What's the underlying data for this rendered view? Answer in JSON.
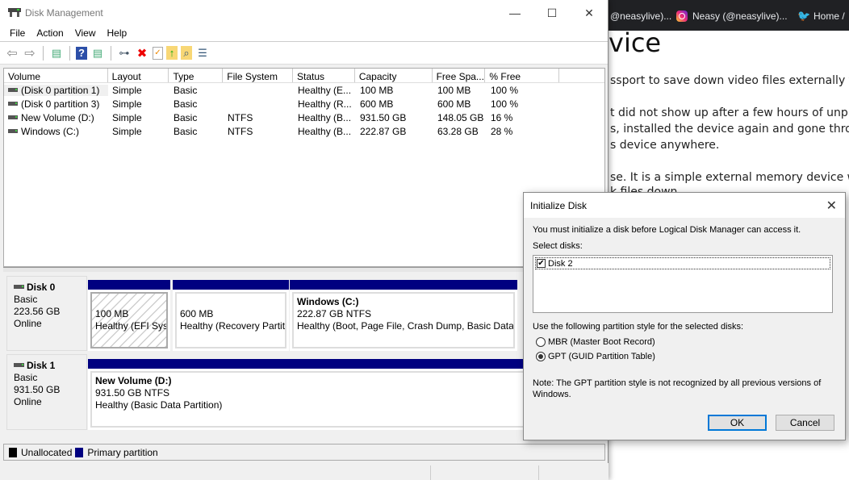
{
  "browser": {
    "bookmarks": [
      {
        "label": "@neasylive)...",
        "icon": "instagram-icon"
      },
      {
        "label": "Neasy (@neasylive)...",
        "icon": "instagram-icon"
      },
      {
        "label": "Home /",
        "icon": "twitter-icon"
      }
    ],
    "heading": "vice",
    "lines": [
      "ssport to save down video files externally for m",
      "t did not show up after a few hours of unplugg",
      "s, installed the device again and gone through",
      "s device anywhere.",
      "se. It is a simple external memory device why",
      "k files down"
    ]
  },
  "window": {
    "title": "Disk Management",
    "controls": {
      "minimize": "—",
      "maximize": "☐",
      "close": "✕"
    },
    "menu": [
      "File",
      "Action",
      "View",
      "Help"
    ],
    "toolbar": [
      {
        "name": "back-icon",
        "glyph": "⇦"
      },
      {
        "name": "forward-icon",
        "glyph": "⇨"
      },
      {
        "name": "show-hide-console-tree-icon",
        "glyph": "▤"
      },
      {
        "name": "help-icon",
        "glyph": "?"
      },
      {
        "name": "show-hide-action-pane-icon",
        "glyph": "▤"
      },
      {
        "name": "connect-drive-icon",
        "glyph": "⊶"
      },
      {
        "name": "delete-icon",
        "glyph": "✖"
      },
      {
        "name": "properties-icon",
        "glyph": "✓"
      },
      {
        "name": "export-icon",
        "glyph": "↑"
      },
      {
        "name": "find-icon",
        "glyph": "⌕"
      },
      {
        "name": "settings-list-icon",
        "glyph": "☰"
      }
    ]
  },
  "volumes": {
    "columns": [
      "Volume",
      "Layout",
      "Type",
      "File System",
      "Status",
      "Capacity",
      "Free Spa...",
      "% Free"
    ],
    "rows": [
      [
        "(Disk 0 partition 1)",
        "Simple",
        "Basic",
        "",
        "Healthy (E...",
        "100 MB",
        "100 MB",
        "100 %"
      ],
      [
        "(Disk 0 partition 3)",
        "Simple",
        "Basic",
        "",
        "Healthy (R...",
        "600 MB",
        "600 MB",
        "100 %"
      ],
      [
        "New Volume (D:)",
        "Simple",
        "Basic",
        "NTFS",
        "Healthy (B...",
        "931.50 GB",
        "148.05 GB",
        "16 %"
      ],
      [
        "Windows (C:)",
        "Simple",
        "Basic",
        "NTFS",
        "Healthy (B...",
        "222.87 GB",
        "63.28 GB",
        "28 %"
      ]
    ]
  },
  "disks": [
    {
      "name": "Disk 0",
      "type": "Basic",
      "size": "223.56 GB",
      "status": "Online",
      "partitions": [
        {
          "title": "",
          "size": "100 MB",
          "status": "Healthy (EFI Syst"
        },
        {
          "title": "",
          "size": "600 MB",
          "status": "Healthy (Recovery Partiti"
        },
        {
          "title": "Windows  (C:)",
          "size": "222.87 GB NTFS",
          "status": "Healthy (Boot, Page File, Crash Dump, Basic Data P"
        }
      ]
    },
    {
      "name": "Disk 1",
      "type": "Basic",
      "size": "931.50 GB",
      "status": "Online",
      "partitions": [
        {
          "title": "New Volume  (D:)",
          "size": "931.50 GB NTFS",
          "status": "Healthy (Basic Data Partition)"
        }
      ]
    }
  ],
  "legend": [
    {
      "label": "Unallocated",
      "color": "#000000"
    },
    {
      "label": "Primary partition",
      "color": "#000080"
    }
  ],
  "dialog": {
    "title": "Initialize Disk",
    "intro": "You must initialize a disk before Logical Disk Manager can access it.",
    "select_label": "Select disks:",
    "disks": [
      {
        "label": "Disk 2",
        "checked": true
      }
    ],
    "style_label": "Use the following partition style for the selected disks:",
    "options": [
      {
        "label": "MBR (Master Boot Record)",
        "selected": false
      },
      {
        "label": "GPT (GUID Partition Table)",
        "selected": true
      }
    ],
    "note_line1": "Note: The GPT partition style is not recognized by all previous versions of",
    "note_line2": "Windows.",
    "ok_label": "OK",
    "cancel_label": "Cancel",
    "close_glyph": "✕"
  }
}
